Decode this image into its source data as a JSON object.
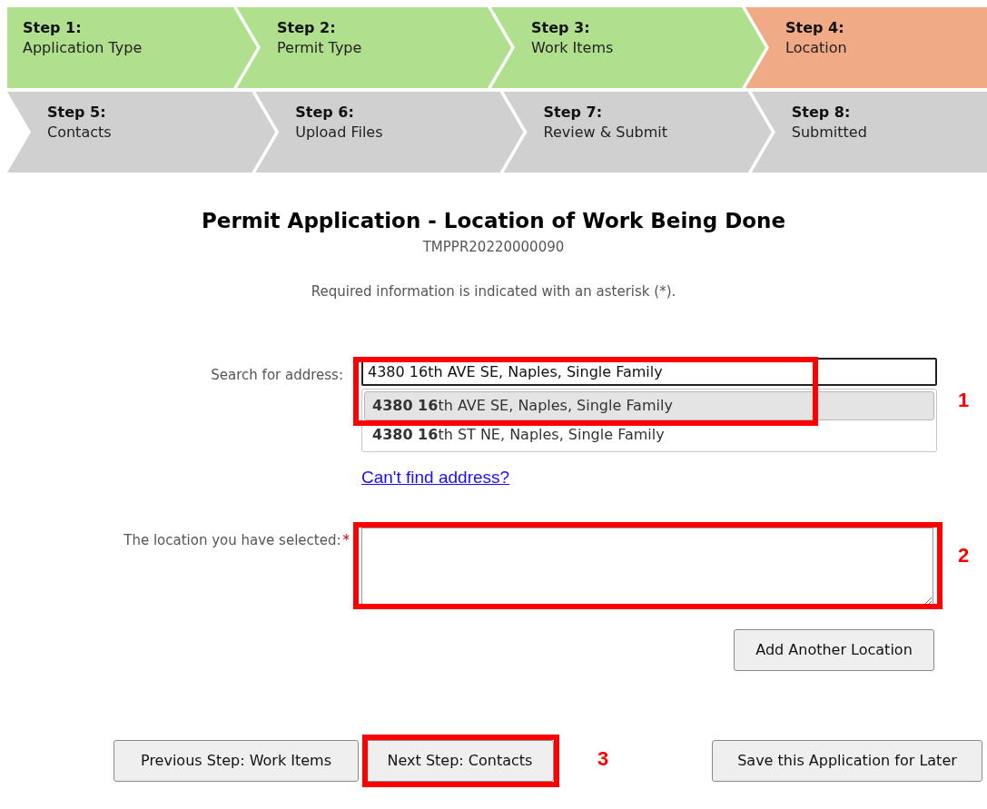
{
  "steps": [
    {
      "number": "Step 1:",
      "name": "Application Type",
      "kind": "complete"
    },
    {
      "number": "Step 2:",
      "name": "Permit Type",
      "kind": "complete"
    },
    {
      "number": "Step 3:",
      "name": "Work Items",
      "kind": "complete"
    },
    {
      "number": "Step 4:",
      "name": "Location",
      "kind": "current"
    },
    {
      "number": "Step 5:",
      "name": "Contacts",
      "kind": "pending"
    },
    {
      "number": "Step 6:",
      "name": "Upload Files",
      "kind": "pending"
    },
    {
      "number": "Step 7:",
      "name": "Review & Submit",
      "kind": "pending"
    },
    {
      "number": "Step 8:",
      "name": "Submitted",
      "kind": "pending"
    }
  ],
  "title": "Permit Application - Location of Work Being Done",
  "reference": "TMPPR20220000090",
  "required_note": "Required information is indicated with an asterisk (*).",
  "search": {
    "label": "Search for address:",
    "value": "4380 16th AVE SE, Naples, Single Family"
  },
  "suggestions": [
    {
      "text": "**4380 16**th AVE SE, Naples, Single Family",
      "selected": true
    },
    {
      "text": "**4380 16**th ST NE, Naples, Single Family",
      "selected": false
    }
  ],
  "cant_find_link": "Can't find address?",
  "location": {
    "label": "The location you have selected:",
    "required_mark": "*"
  },
  "add_location_button": "Add Another Location",
  "previous_button": "Previous Step: Work Items",
  "next_button": "Next Step: Contacts",
  "save_button": "Save this Application for Later",
  "annotations": [
    {
      "label": "1"
    },
    {
      "label": "2"
    },
    {
      "label": "3"
    }
  ]
}
